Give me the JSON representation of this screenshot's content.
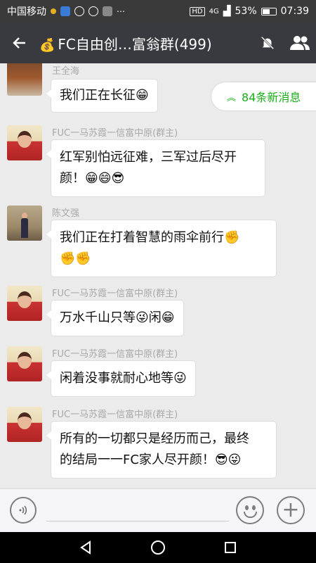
{
  "status_bar": {
    "carrier": "中国移动",
    "network": "4G",
    "battery": "53%",
    "time": "07:39",
    "hd": "HD"
  },
  "header": {
    "title": "FC自由创…富翁群(499)",
    "back_icon": "arrow-left-icon",
    "mute_icon": "bell-muted-icon",
    "members_icon": "group-icon"
  },
  "new_messages": "84条新消息",
  "messages": [
    {
      "sender": "王全海",
      "text": "我们正在长征😁"
    },
    {
      "sender": "FUC一马苏霞一信富中原(群主)",
      "text_line1": "红军别怕远征难，三军过后尽开",
      "text_line2": "颜！😁😄😎"
    },
    {
      "sender": "陈文强",
      "text_line1": "我们正在打着智慧的雨伞前行✊",
      "text_line2": "✊✊"
    },
    {
      "sender": "FUC一马苏霞一信富中原(群主)",
      "text": "万水千山只等😜闲😁"
    },
    {
      "sender": "FUC一马苏霞一信富中原(群主)",
      "text": "闲着没事就耐心地等😜"
    },
    {
      "sender": "FUC一马苏霞一信富中原(群主)",
      "text_line1": "所有的一切都只是经历而己，最终",
      "text_line2": "的结局一一FC家人尽开颜！😎😜"
    }
  ],
  "colors": {
    "header_bg": "#393a3f",
    "chat_bg": "#ebebeb",
    "accent_green": "#1aad19"
  }
}
